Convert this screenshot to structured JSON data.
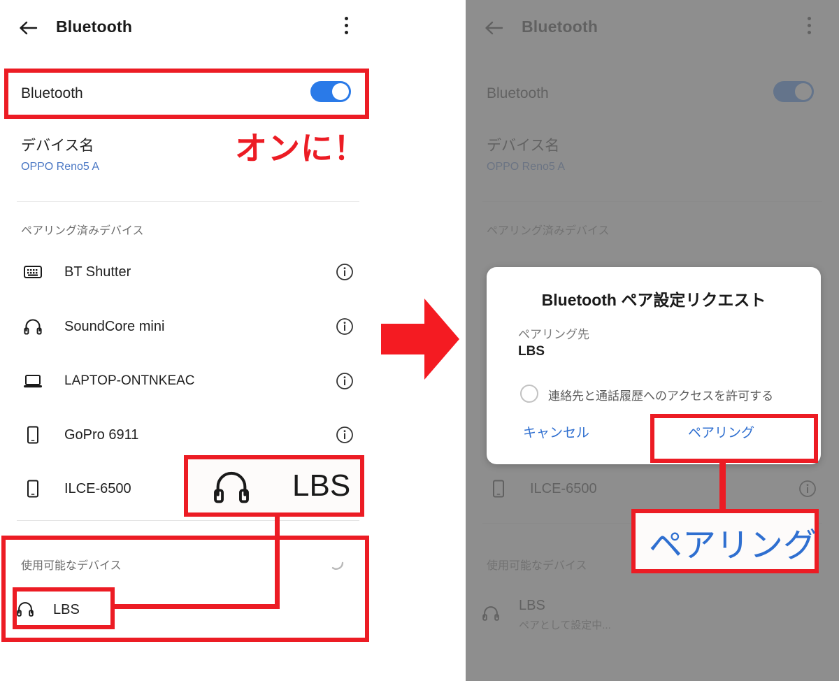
{
  "left_phone": {
    "appbar": {
      "title": "Bluetooth",
      "back_icon": "back-arrow-icon",
      "menu_icon": "kebab-menu-icon"
    },
    "bluetooth_row": {
      "label": "Bluetooth",
      "toggle_state": "on"
    },
    "device_name": {
      "label": "デバイス名",
      "value": "OPPO Reno5 A"
    },
    "paired_section": {
      "title": "ペアリング済みデバイス"
    },
    "paired_devices": [
      {
        "name": "BT Shutter",
        "icon": "keyboard-icon",
        "info": "info-icon"
      },
      {
        "name": "SoundCore mini",
        "icon": "headphones-icon",
        "info": "info-icon"
      },
      {
        "name": "LAPTOP-ONTNKEAC",
        "icon": "laptop-icon",
        "info": "info-icon"
      },
      {
        "name": "GoPro 6911",
        "icon": "phone-icon",
        "info": "info-icon"
      },
      {
        "name": "ILCE-6500",
        "icon": "phone-icon",
        "info": "info-icon"
      }
    ],
    "available_section": {
      "title": "使用可能なデバイス",
      "spinner": "scanning-spinner-icon"
    },
    "available_devices": [
      {
        "name": "LBS",
        "icon": "headphones-icon"
      }
    ]
  },
  "annotations_left": {
    "turn_on_text": "オンに！",
    "magnified_device_name": "LBS",
    "magnified_device_icon": "headphones-icon"
  },
  "transition": {
    "arrow_icon": "right-arrow-icon",
    "color": "#ec1c24"
  },
  "right_phone": {
    "appbar": {
      "title": "Bluetooth",
      "back_icon": "back-arrow-icon",
      "menu_icon": "kebab-menu-icon"
    },
    "bluetooth_row": {
      "label": "Bluetooth",
      "toggle_state": "on"
    },
    "device_name": {
      "label": "デバイス名",
      "value": "OPPO Reno5 A"
    },
    "paired_section": {
      "title": "ペアリング済みデバイス"
    },
    "paired_devices": [
      {
        "name": "ILCE-6500",
        "icon": "phone-icon",
        "info": "info-icon"
      }
    ],
    "available_section": {
      "title": "使用可能なデバイス"
    },
    "available_devices": [
      {
        "name": "LBS",
        "status": "ペアとして設定中...",
        "icon": "headphones-icon"
      }
    ],
    "dialog": {
      "title": "Bluetooth ペア設定リクエスト",
      "target_label": "ペアリング先",
      "target_value": "LBS",
      "permission_label": "連絡先と通話履歴へのアクセスを許可する",
      "permission_checked": false,
      "cancel_label": "キャンセル",
      "confirm_label": "ペアリング"
    }
  },
  "annotations_right": {
    "callout_text": "ペアリング"
  },
  "colors": {
    "accent_red": "#ec1c24",
    "toggle_blue": "#2a7ae8",
    "link_blue": "#4a77c4",
    "button_blue": "#2f6fd0",
    "scrim_gray": "#737373"
  }
}
